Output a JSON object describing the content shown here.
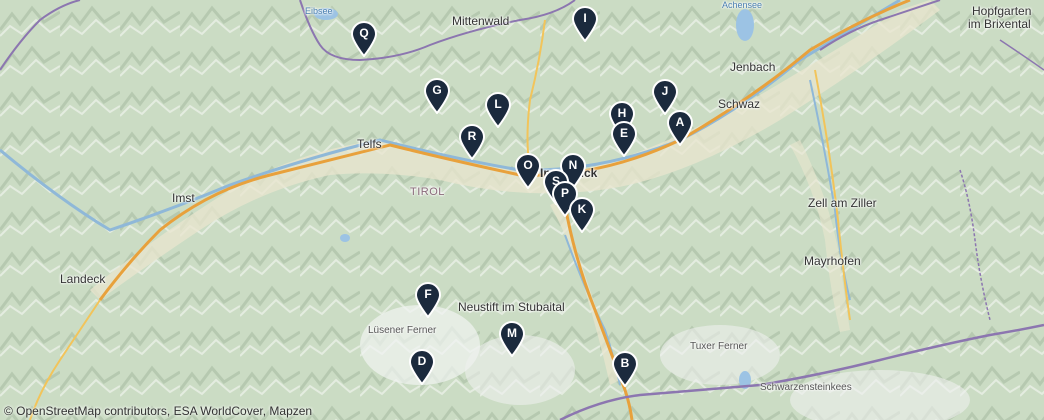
{
  "places": {
    "eibsee": "Eibsee",
    "mittenwald": "Mittenwald",
    "achensee": "Achensee",
    "hopfgarten": "Hopfgarten",
    "brixental": "im Brixental",
    "jenbach": "Jenbach",
    "schwaz": "Schwaz",
    "telfs": "Telfs",
    "innsbruck": "Innsbruck",
    "tirol": "TIROL",
    "imst": "Imst",
    "landeck": "Landeck",
    "zell": "Zell am Ziller",
    "mayrhofen": "Mayrhofen",
    "neustift": "Neustift im Stubaital",
    "luesener": "Lüsener Ferner",
    "tuxer": "Tuxer Ferner",
    "schwarzenstein": "Schwarzensteinkees"
  },
  "markers": [
    "Q",
    "I",
    "G",
    "L",
    "J",
    "H",
    "E",
    "A",
    "R",
    "O",
    "N",
    "S",
    "P",
    "K",
    "F",
    "M",
    "D",
    "B"
  ],
  "marker_color": "#1b2a3d",
  "attribution": "© OpenStreetMap contributors, ESA WorldCover, Mapzen"
}
